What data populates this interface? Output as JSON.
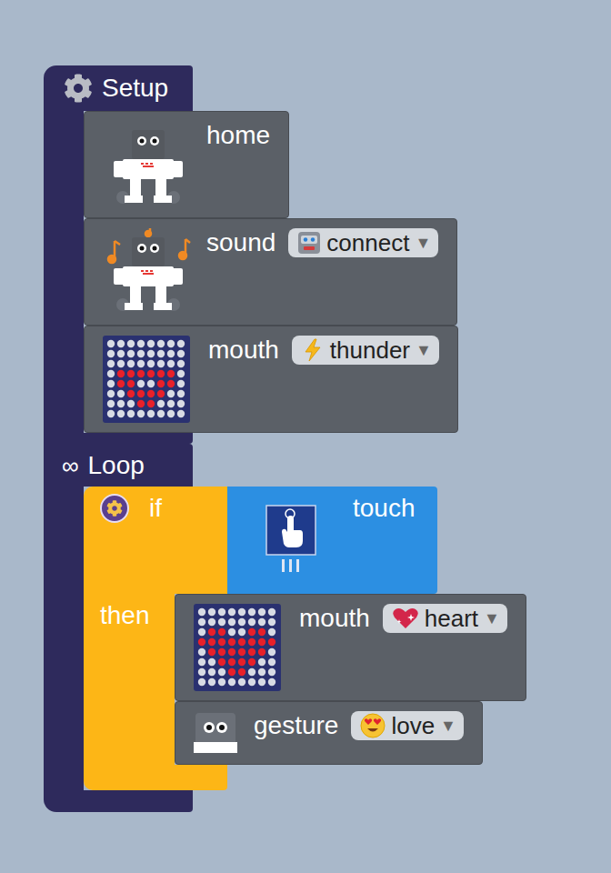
{
  "events": [
    {
      "kind": "start",
      "symbol": "",
      "label": "Setup",
      "blocks": [
        {
          "kind": "pose",
          "label": "home"
        },
        {
          "kind": "tune",
          "label": "sound",
          "dropdown": {
            "value": "connect",
            "arrow": "▼"
          }
        },
        {
          "kind": "matrix",
          "label": "mouth",
          "dropdown": {
            "value": "thunder",
            "arrow": "▼"
          }
        }
      ]
    },
    {
      "kind": "repeat",
      "symbol": "∞",
      "label": "Loop",
      "blocks": [
        {
          "kind": "branch",
          "label": "if",
          "then": "then",
          "condition": {
            "kind": "sensor",
            "label": "touch"
          },
          "blocks": [
            {
              "kind": "matrix",
              "label": "mouth",
              "dropdown": {
                "value": "heart",
                "arrow": "▼"
              }
            },
            {
              "kind": "expression",
              "label": "gesture",
              "dropdown": {
                "value": "love",
                "arrow": "▼"
              }
            }
          ]
        }
      ]
    }
  ]
}
